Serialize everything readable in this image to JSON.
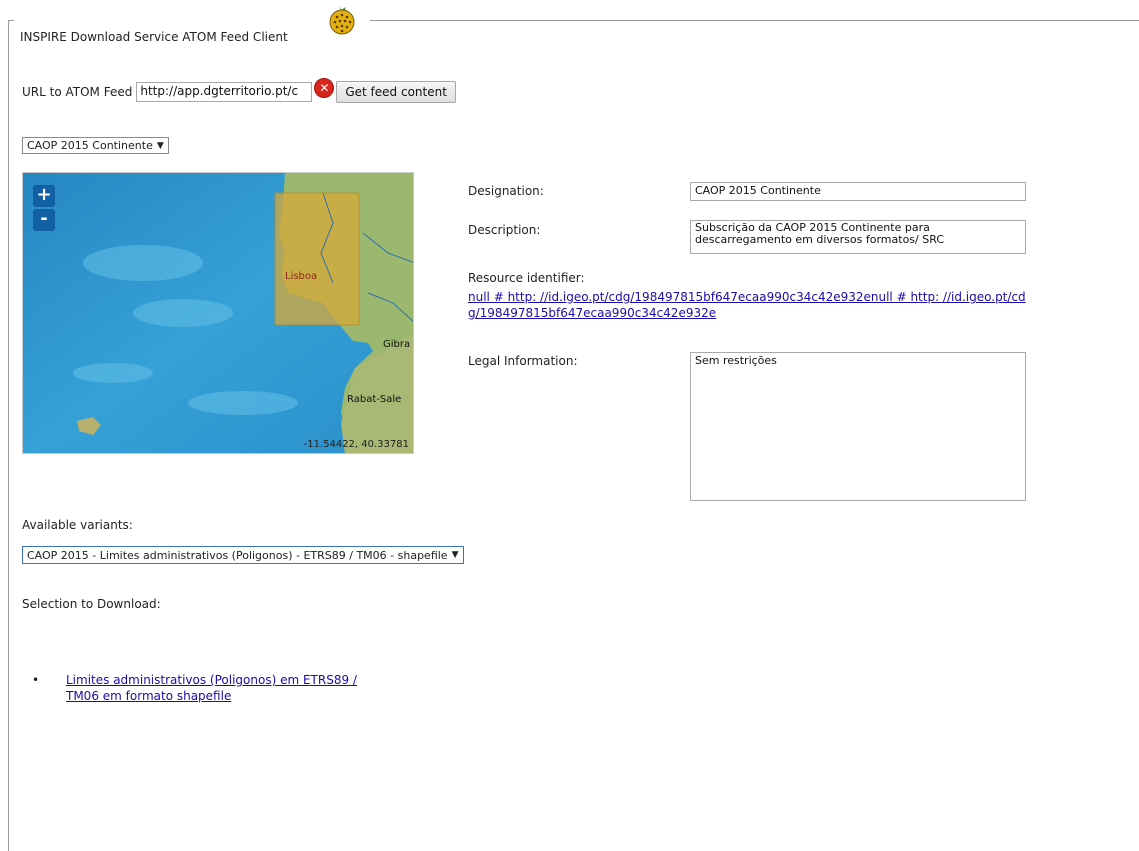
{
  "app": {
    "title": "INSPIRE Download Service ATOM Feed Client",
    "logo_icon": "globe-logo-icon"
  },
  "feed": {
    "url_label": "URL to ATOM Feed",
    "url_value": "http://app.dgterritorio.pt/c",
    "clear_icon": "clear-x-icon",
    "get_button": "Get feed content"
  },
  "dataset_select": {
    "selected": "CAOP 2015 Continente"
  },
  "map": {
    "zoom_in": "+",
    "zoom_out": "-",
    "labels": {
      "lisboa": "Lisboa",
      "gibra": "Gibra",
      "rabat": "Rabat-Sale"
    },
    "coords": "-11.54422, 40.33781"
  },
  "details": {
    "designation_label": "Designation:",
    "designation_value": "CAOP 2015 Continente",
    "description_label": "Description:",
    "description_value": "Subscrição da CAOP 2015 Continente para descarregamento em diversos formatos/ SRC",
    "resource_label": "Resource identifier:",
    "resource_value": "null # http: //id.igeo.pt/cdg/198497815bf647ecaa990c34c42e932enull # http: //id.igeo.pt/cdg/198497815bf647ecaa990c34c42e932e",
    "legal_label": "Legal Information:",
    "legal_value": "Sem restrições"
  },
  "variants": {
    "label": "Available variants:",
    "selected": "CAOP 2015 - Limites administrativos (Poligonos) - ETRS89 / TM06 - shapefile"
  },
  "download": {
    "label": "Selection to Download:",
    "items": [
      "Limites administrativos (Poligonos) em ETRS89 / TM06 em formato shapefile"
    ]
  },
  "colors": {
    "link": "#1a0dab",
    "highlight": "#d8a838",
    "sea": "#2d94cc"
  }
}
